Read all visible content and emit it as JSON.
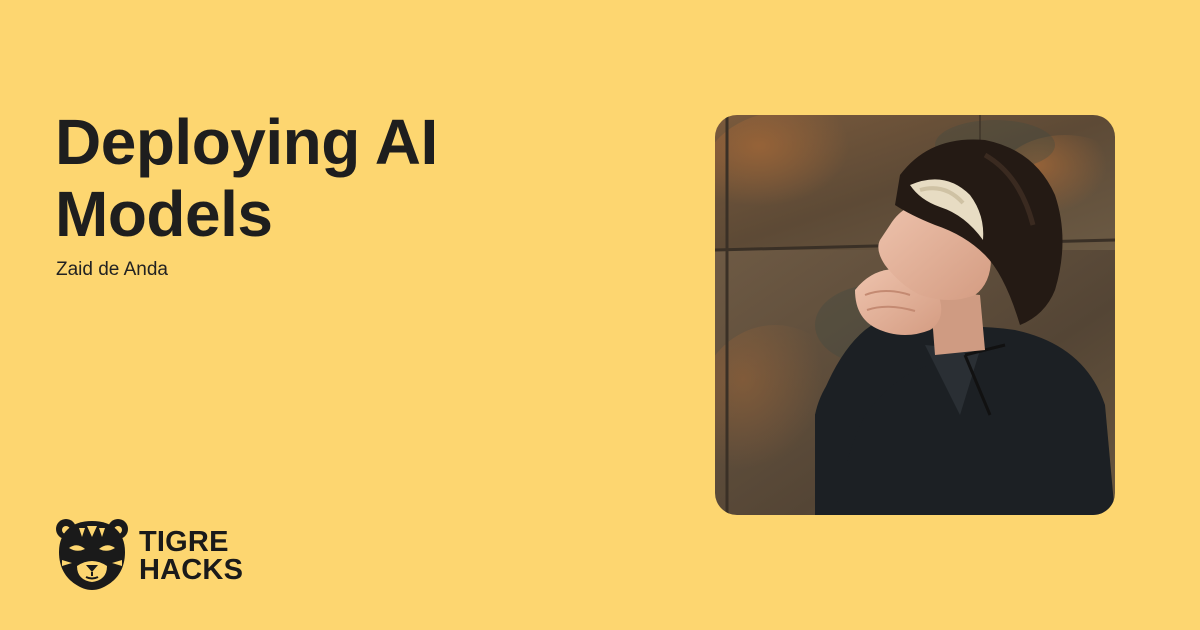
{
  "card": {
    "title_line1": "Deploying AI",
    "title_line2": "Models",
    "speaker": "Zaid de Anda",
    "background_color": "#fdd670",
    "text_color": "#1e1e1e"
  },
  "brand": {
    "icon": "tiger-head-icon",
    "line1": "TIGRE",
    "line2": "HACKS"
  },
  "photo": {
    "subject": "speaker-portrait"
  }
}
